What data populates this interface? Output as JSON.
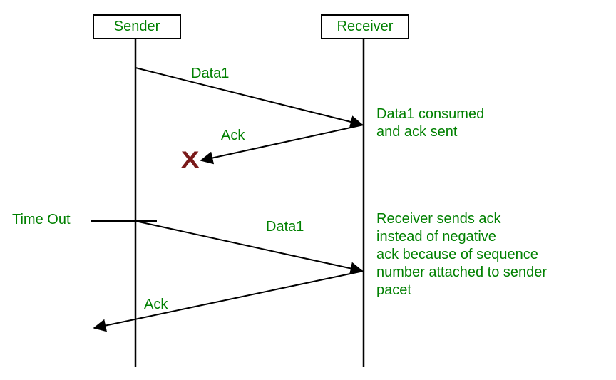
{
  "chart_data": {
    "type": "sequence-diagram",
    "participants": [
      "Sender",
      "Receiver"
    ],
    "messages": [
      {
        "from": "Sender",
        "to": "Receiver",
        "label": "Data1",
        "note_right": "Data1 consumed\nand ack sent"
      },
      {
        "from": "Receiver",
        "to": "Sender",
        "label": "Ack",
        "lost": true
      },
      {
        "from": "Sender",
        "to": "Receiver",
        "label": "Data1",
        "trigger_left": "Time Out",
        "note_right": "Receiver sends ack\ninstead of negative\nack because of sequence\nnumber attached to sender\npacet"
      },
      {
        "from": "Receiver",
        "to": "Sender",
        "label": "Ack"
      }
    ]
  },
  "boxes": {
    "sender": "Sender",
    "receiver": "Receiver"
  },
  "labels": {
    "data1_a": "Data1",
    "ack_a": "Ack",
    "data1_b": "Data1",
    "ack_b": "Ack",
    "timeout": "Time Out",
    "note1": "Data1 consumed\nand ack sent",
    "note2": "Receiver sends ack\ninstead of negative\nack because of sequence\nnumber attached to sender\npacet"
  },
  "x_mark": "X"
}
